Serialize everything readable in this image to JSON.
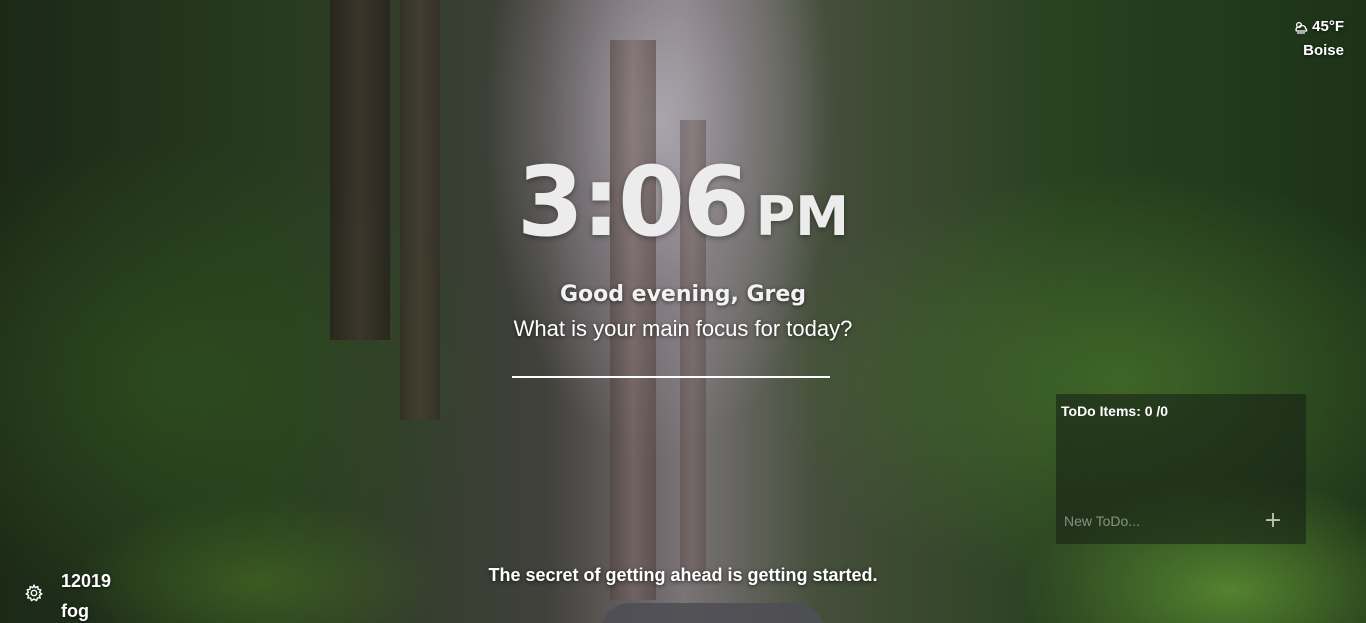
{
  "weather": {
    "temperature": "45°F",
    "location": "Boise",
    "icon": "fog-cloud-icon"
  },
  "clock": {
    "time": "3:06",
    "ampm": "PM"
  },
  "greeting": {
    "text": "Good evening, Greg"
  },
  "focus": {
    "question": "What is your main focus for today?",
    "value": ""
  },
  "todo": {
    "title": "ToDo Items: 0 /0",
    "placeholder": "New ToDo...",
    "add_label": "+"
  },
  "quote": {
    "text": "The secret of getting ahead is getting started."
  },
  "footer": {
    "settings_icon": "gear-icon",
    "line1": "12019",
    "line2": "fog"
  }
}
